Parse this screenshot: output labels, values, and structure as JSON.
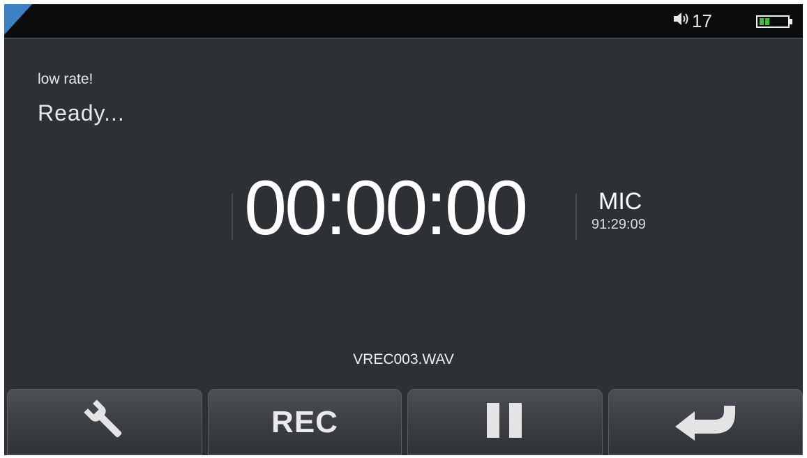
{
  "status_bar": {
    "volume_icon": "speaker-icon",
    "volume_level": "17",
    "battery_icon": "battery-icon",
    "battery_color": "#3fbf3f"
  },
  "info": {
    "message": "low rate!",
    "status": "Ready..."
  },
  "recorder": {
    "timer": "00:00:00",
    "source": "MIC",
    "remaining": "91:29:09",
    "filename": "VREC003.WAV"
  },
  "toolbar": {
    "settings_icon": "wrench-icon",
    "rec_label": "REC",
    "pause_icon": "pause-icon",
    "back_icon": "return-arrow-icon"
  },
  "colors": {
    "background": "#2d3034",
    "status_bar": "#0b0c0d",
    "accent_corner": "#3f7fc4"
  }
}
